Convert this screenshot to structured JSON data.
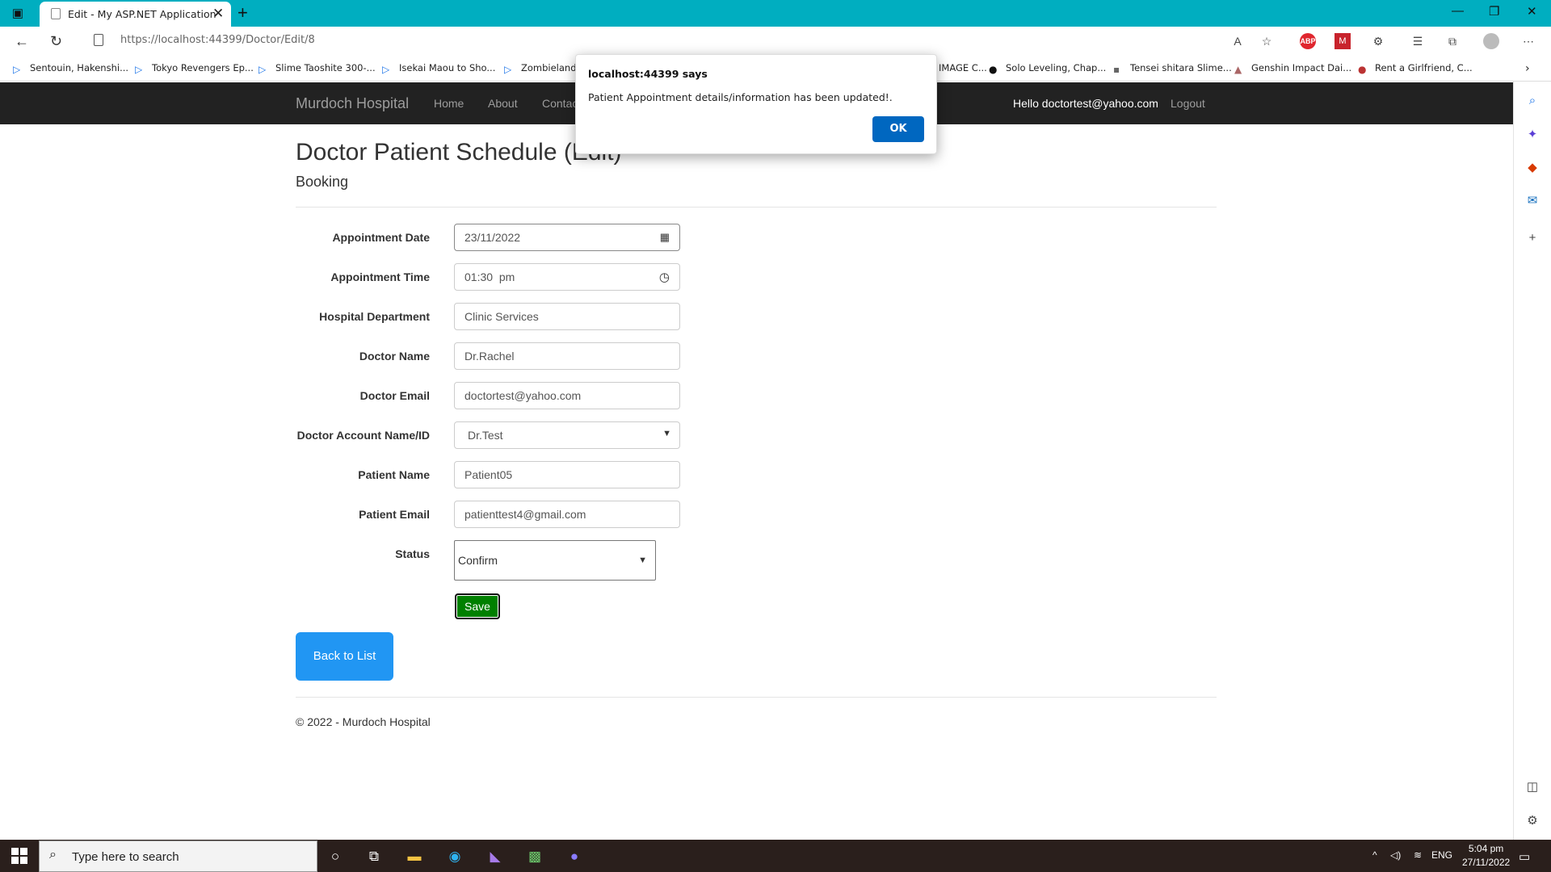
{
  "browser": {
    "tab_title": "Edit - My ASP.NET Application",
    "url": "https://localhost:44399/Doctor/Edit/8",
    "favorites": [
      "Sentouin, Hakenshi...",
      "Tokyo Revengers Ep...",
      "Slime Taoshite 300-...",
      "Isekai Maou to Sho...",
      "Zombieland",
      "IMAGE C...",
      "Solo Leveling, Chap...",
      "Tensei shitara Slime...",
      "Genshin Impact Dai...",
      "Rent a Girlfriend, C..."
    ]
  },
  "nav": {
    "brand": "Murdoch Hospital",
    "links": [
      "Home",
      "About",
      "Contact"
    ],
    "greeting": "Hello doctortest@yahoo.com",
    "logout": "Logout"
  },
  "page": {
    "title": "Doctor Patient Schedule (Edit)",
    "subtitle": "Booking",
    "fields": [
      {
        "label": "Appointment Date",
        "value": "23/11/2022",
        "icon": "calendar-icon"
      },
      {
        "label": "Appointment Time",
        "value": "01:30  pm",
        "icon": "clock-icon"
      },
      {
        "label": "Hospital Department",
        "value": "Clinic Services"
      },
      {
        "label": "Doctor Name",
        "value": "Dr.Rachel"
      },
      {
        "label": "Doctor Email",
        "value": "doctortest@yahoo.com"
      },
      {
        "label": "Doctor Account Name/ID",
        "value": "Dr.Test",
        "type": "select"
      },
      {
        "label": "Patient Name",
        "value": "Patient05"
      },
      {
        "label": "Patient Email",
        "value": "patienttest4@gmail.com"
      }
    ],
    "status_label": "Status",
    "status_value": "Confirm",
    "save_label": "Save",
    "back_label": "Back to List",
    "footer": "© 2022 - Murdoch Hospital"
  },
  "dialog": {
    "title": "localhost:44399 says",
    "message": "Patient Appointment details/information has been updated!.",
    "ok_label": "OK"
  },
  "taskbar": {
    "search_placeholder": "Type here to search",
    "language": "ENG",
    "time": "5:04 pm",
    "date": "27/11/2022"
  }
}
